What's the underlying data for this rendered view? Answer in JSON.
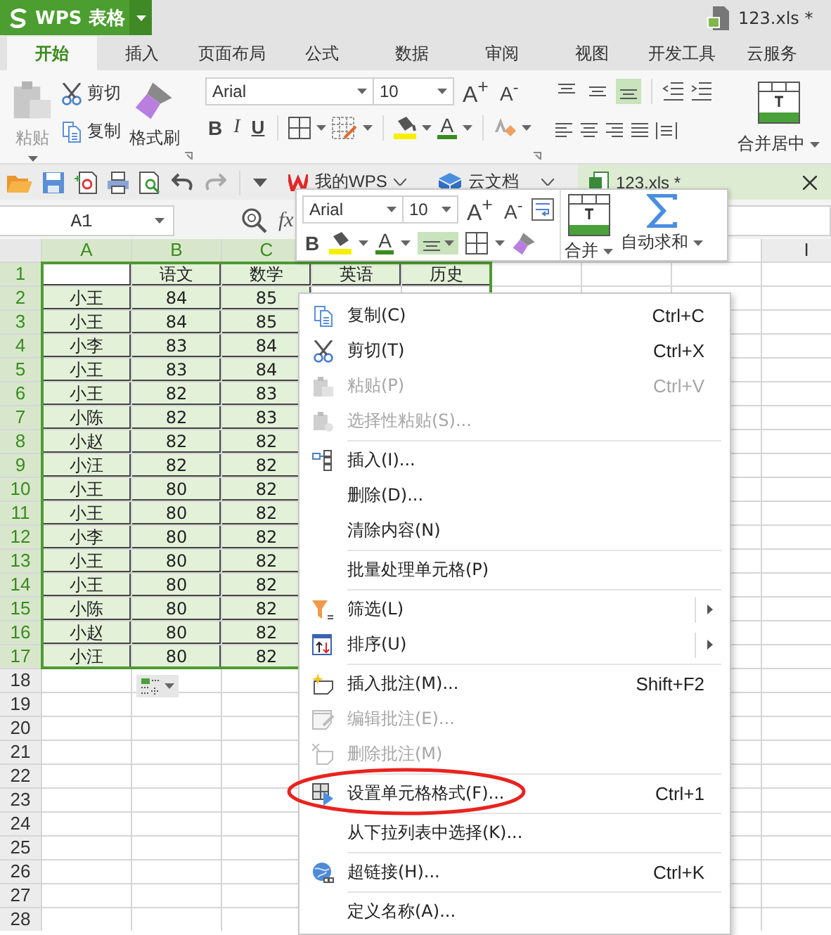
{
  "title_bar": {
    "app_name": "WPS 表格",
    "file_name": "123.xls *"
  },
  "ribbon_tabs": [
    {
      "label": "开始",
      "selected": true
    },
    {
      "label": "插入",
      "selected": false
    },
    {
      "label": "页面布局",
      "selected": false
    },
    {
      "label": "公式",
      "selected": false
    },
    {
      "label": "数据",
      "selected": false
    },
    {
      "label": "审阅",
      "selected": false
    },
    {
      "label": "视图",
      "selected": false
    },
    {
      "label": "开发工具",
      "selected": false
    },
    {
      "label": "云服务",
      "selected": false
    }
  ],
  "clipboard": {
    "paste": {
      "label": "粘贴",
      "disabled": true
    },
    "cut": "剪切",
    "copy": "复制",
    "format_painter": "格式刷"
  },
  "font": {
    "name": "Arial",
    "size": "10",
    "grow": "A$^{+}$",
    "shrink": "A$^{-}$",
    "bold": "B",
    "italic": "I",
    "underline": "U",
    "font_color": "A"
  },
  "vertical_align": [
    {
      "selected": false
    },
    {
      "selected": false
    },
    {
      "selected": true
    }
  ],
  "merge": {
    "label": "合并居中"
  },
  "doc_tabs": [
    {
      "kind": "wps",
      "label": "我的WPS",
      "selected": false
    },
    {
      "kind": "cloud",
      "label": "云文档",
      "selected": false
    },
    {
      "kind": "sheet",
      "label": "123.xls *",
      "selected": true
    }
  ],
  "name_box": "A1",
  "formula_label": "fx",
  "grid": {
    "columns": [
      {
        "header": "A",
        "selected": true
      },
      {
        "header": "B",
        "selected": true
      },
      {
        "header": "C",
        "selected": true
      },
      null,
      null,
      null,
      null,
      null,
      {
        "header": "I",
        "selected": false
      }
    ],
    "rows": [
      {
        "number": "1",
        "selected": true,
        "active": true,
        "cells": [
          null,
          "语文",
          "数学",
          "英语",
          "历史"
        ]
      },
      {
        "number": "2",
        "selected": true,
        "cells": [
          "小王",
          "84",
          "85"
        ]
      },
      {
        "number": "3",
        "selected": true,
        "cells": [
          "小王",
          "84",
          "85"
        ]
      },
      {
        "number": "4",
        "selected": true,
        "cells": [
          "小李",
          "83",
          "84"
        ]
      },
      {
        "number": "5",
        "selected": true,
        "cells": [
          "小王",
          "83",
          "84"
        ]
      },
      {
        "number": "6",
        "selected": true,
        "cells": [
          "小王",
          "82",
          "83"
        ]
      },
      {
        "number": "7",
        "selected": true,
        "cells": [
          "小陈",
          "82",
          "83"
        ]
      },
      {
        "number": "8",
        "selected": true,
        "cells": [
          "小赵",
          "82",
          "82"
        ]
      },
      {
        "number": "9",
        "selected": true,
        "cells": [
          "小汪",
          "82",
          "82"
        ]
      },
      {
        "number": "10",
        "selected": true,
        "cells": [
          "小王",
          "80",
          "82"
        ]
      },
      {
        "number": "11",
        "selected": true,
        "cells": [
          "小王",
          "80",
          "82"
        ]
      },
      {
        "number": "12",
        "selected": true,
        "cells": [
          "小李",
          "80",
          "82"
        ]
      },
      {
        "number": "13",
        "selected": true,
        "cells": [
          "小王",
          "80",
          "82"
        ]
      },
      {
        "number": "14",
        "selected": true,
        "cells": [
          "小王",
          "80",
          "82"
        ]
      },
      {
        "number": "15",
        "selected": true,
        "cells": [
          "小陈",
          "80",
          "82"
        ]
      },
      {
        "number": "16",
        "selected": true,
        "cells": [
          "小赵",
          "80",
          "82"
        ]
      },
      {
        "number": "17",
        "selected": true,
        "cells": [
          "小汪",
          "80",
          "82"
        ]
      },
      {
        "number": "18",
        "selected": false,
        "paste_options": true
      },
      {
        "number": "19",
        "selected": false
      },
      {
        "number": "20",
        "selected": false
      },
      {
        "number": "21",
        "selected": false
      },
      {
        "number": "22",
        "selected": false
      },
      {
        "number": "23",
        "selected": false
      },
      {
        "number": "24",
        "selected": false
      },
      {
        "number": "25",
        "selected": false
      },
      {
        "number": "26",
        "selected": false
      },
      {
        "number": "27",
        "selected": false
      },
      {
        "number": "28",
        "selected": false
      }
    ]
  },
  "mini_toolbar": {
    "font": "Arial",
    "size": "10",
    "grow": "A$^{+}$",
    "shrink": "A$^{-}$",
    "bold": "B",
    "font_color": "A",
    "center_align": {
      "selected": true
    },
    "merge": "合并",
    "autosum": "自动求和"
  },
  "context_menu": [
    {
      "kind": "item",
      "label": "复制(C)",
      "shortcut": "Ctrl+C",
      "disabled": false
    },
    {
      "kind": "item",
      "label": "剪切(T)",
      "shortcut": "Ctrl+X",
      "disabled": false
    },
    {
      "kind": "item",
      "label": "粘贴(P)",
      "shortcut": "Ctrl+V",
      "disabled": true
    },
    {
      "kind": "item",
      "label": "选择性粘贴(S)...",
      "disabled": true
    },
    {
      "kind": "separator"
    },
    {
      "kind": "item",
      "label": "插入(I)...",
      "disabled": false
    },
    {
      "kind": "item",
      "label": "删除(D)...",
      "disabled": false
    },
    {
      "kind": "item",
      "label": "清除内容(N)",
      "disabled": false
    },
    {
      "kind": "separator"
    },
    {
      "kind": "item",
      "label": "批量处理单元格(P)",
      "disabled": false
    },
    {
      "kind": "separator"
    },
    {
      "kind": "item",
      "label": "筛选(L)",
      "disabled": false,
      "submenu": true
    },
    {
      "kind": "item",
      "label": "排序(U)",
      "disabled": false,
      "submenu": true
    },
    {
      "kind": "separator"
    },
    {
      "kind": "item",
      "label": "插入批注(M)...",
      "shortcut": "Shift+F2",
      "disabled": false
    },
    {
      "kind": "item",
      "label": "编辑批注(E)...",
      "disabled": true
    },
    {
      "kind": "item",
      "label": "删除批注(M)",
      "disabled": true
    },
    {
      "kind": "separator"
    },
    {
      "kind": "item",
      "label": "设置单元格格式(F)...",
      "shortcut": "Ctrl+1",
      "disabled": false,
      "circled": true
    },
    {
      "kind": "separator"
    },
    {
      "kind": "item",
      "label": "从下拉列表中选择(K)...",
      "disabled": false
    },
    {
      "kind": "separator"
    },
    {
      "kind": "item",
      "label": "超链接(H)...",
      "shortcut": "Ctrl+K",
      "disabled": false
    },
    {
      "kind": "separator"
    },
    {
      "kind": "item",
      "label": "定义名称(A)...",
      "disabled": false
    }
  ]
}
